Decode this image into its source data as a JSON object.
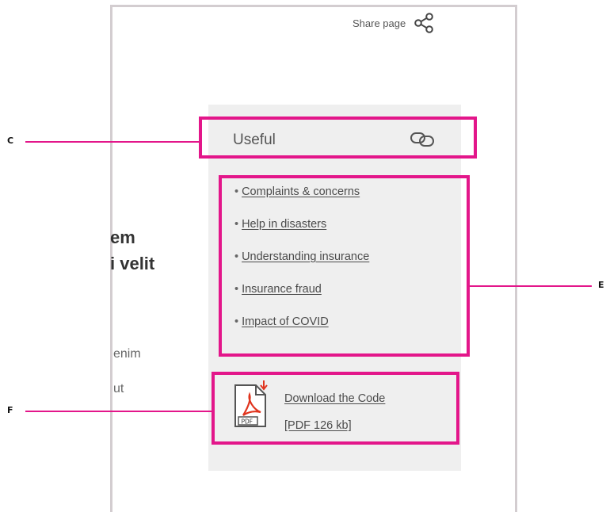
{
  "page": {
    "share_label": "Share page",
    "heading_fragments": [
      "em",
      "i velit"
    ],
    "paragraph_fragments": [
      "enim",
      "ut"
    ]
  },
  "useful": {
    "title": "Useful",
    "links": [
      "Complaints & concerns",
      "Help in disasters",
      "Understanding insurance",
      "Insurance fraud",
      "Impact of COVID"
    ],
    "download_line1": "Download the Code",
    "download_line2": "[PDF 126 kb]",
    "pdf_icon_text": "PDF"
  },
  "annotations": {
    "c": "C",
    "e": "E",
    "f": "F",
    "color": "#e3168a"
  }
}
